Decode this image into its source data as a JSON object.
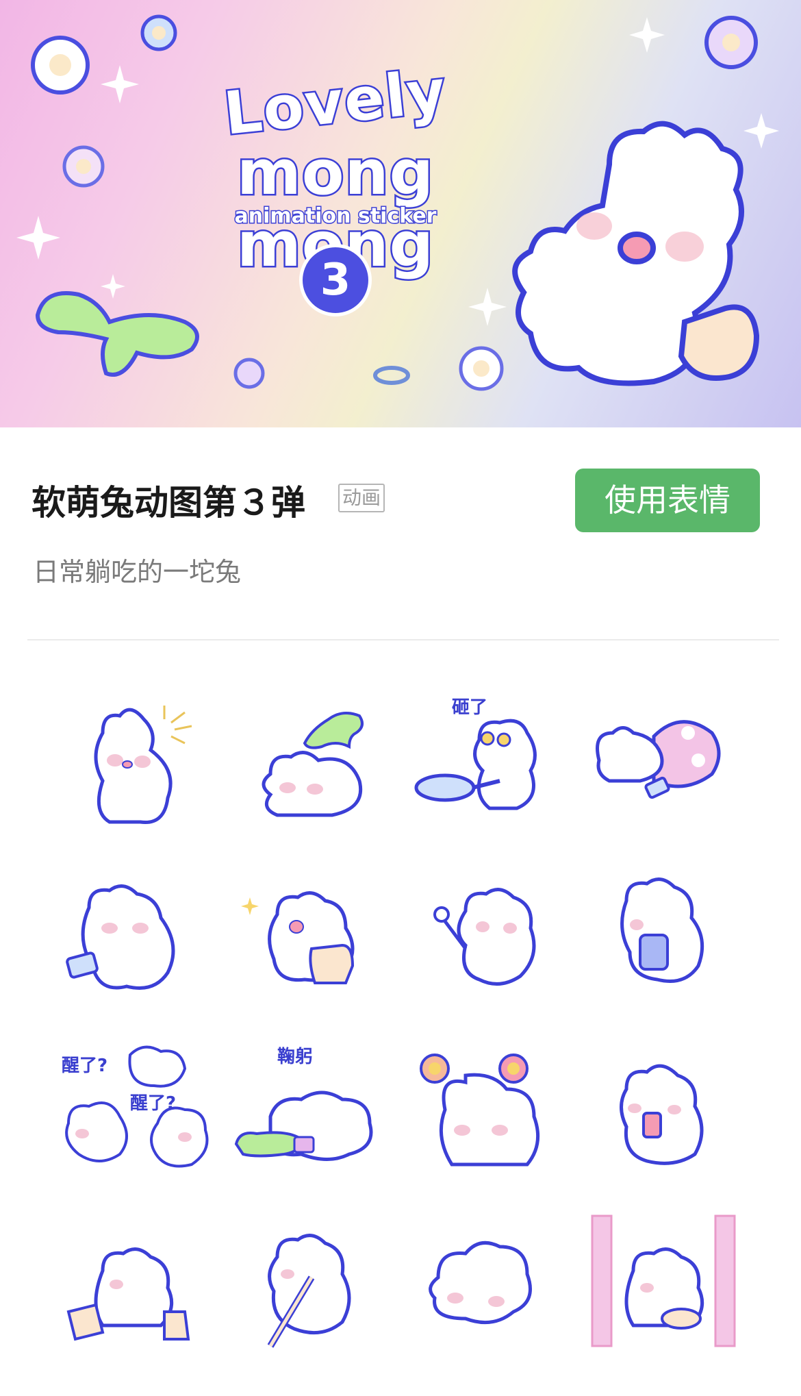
{
  "banner": {
    "title_line1": "Lovely",
    "title_line2": "mong mong",
    "subtitle": "animation sticker",
    "number": "3"
  },
  "pack": {
    "title": "软萌兔动图第３弹",
    "type_badge": "动画",
    "use_button_label": "使用表情",
    "description": "日常躺吃的一坨兔"
  },
  "colors": {
    "accent_button": "#5ab76a",
    "sticker_outline": "#3b3fd6",
    "blush": "#f4c6d6"
  },
  "stickers": [
    {
      "name": "bunny-waving-sparkle",
      "caption": ""
    },
    {
      "name": "bunny-lying-with-dino",
      "caption": ""
    },
    {
      "name": "bunny-pan-dizzy",
      "caption": "砸了"
    },
    {
      "name": "bunny-under-blanket-phone",
      "caption": ""
    },
    {
      "name": "bunny-lying-phone",
      "caption": ""
    },
    {
      "name": "bunny-with-bag",
      "caption": ""
    },
    {
      "name": "bunny-eating-spoon",
      "caption": ""
    },
    {
      "name": "bunny-drinking",
      "caption": ""
    },
    {
      "name": "bunny-wake-up-group",
      "caption": "醒了?",
      "caption2": "醒了?"
    },
    {
      "name": "bunny-bowing-dino",
      "caption": "鞠躬"
    },
    {
      "name": "bunny-flower-antennae",
      "caption": ""
    },
    {
      "name": "bunny-holding-phone",
      "caption": ""
    },
    {
      "name": "bunny-shopping-bags",
      "caption": ""
    },
    {
      "name": "bunny-playing-flute",
      "caption": ""
    },
    {
      "name": "bunny-lying-sleepy",
      "caption": ""
    },
    {
      "name": "bunny-banner-bowl",
      "caption": ""
    }
  ]
}
